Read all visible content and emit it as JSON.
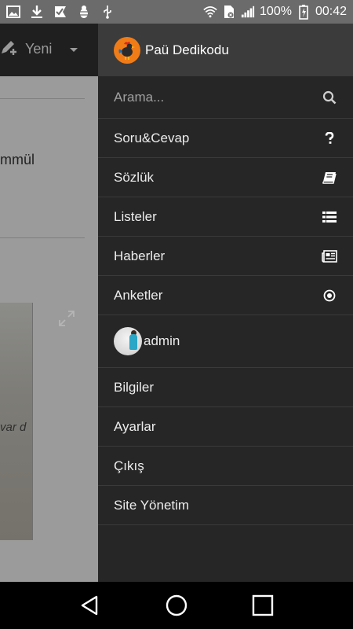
{
  "status_bar": {
    "battery": "100%",
    "time": "00:42"
  },
  "background_app": {
    "toolbar_new_label": "Yeni",
    "text_fragment": "mmül",
    "photo_text_fragment": "var d"
  },
  "drawer": {
    "app_title": "Paü Dedikodu",
    "search": {
      "placeholder": "Arama...",
      "value": ""
    },
    "menu": [
      {
        "label": "Soru&Cevap",
        "icon": "question-icon"
      },
      {
        "label": "Sözlük",
        "icon": "book-icon"
      },
      {
        "label": "Listeler",
        "icon": "list-icon"
      },
      {
        "label": "Haberler",
        "icon": "newspaper-icon"
      },
      {
        "label": "Anketler",
        "icon": "poll-icon"
      }
    ],
    "user": {
      "name": "admin"
    },
    "secondary_menu": [
      {
        "label": "Bilgiler"
      },
      {
        "label": "Ayarlar"
      },
      {
        "label": "Çıkış"
      },
      {
        "label": "Site Yönetim"
      }
    ]
  },
  "colors": {
    "drawer_bg": "#262626",
    "drawer_header_bg": "#3b3b3b",
    "status_bar_bg": "#6b6b6b",
    "logo_accent": "#f07c18"
  }
}
